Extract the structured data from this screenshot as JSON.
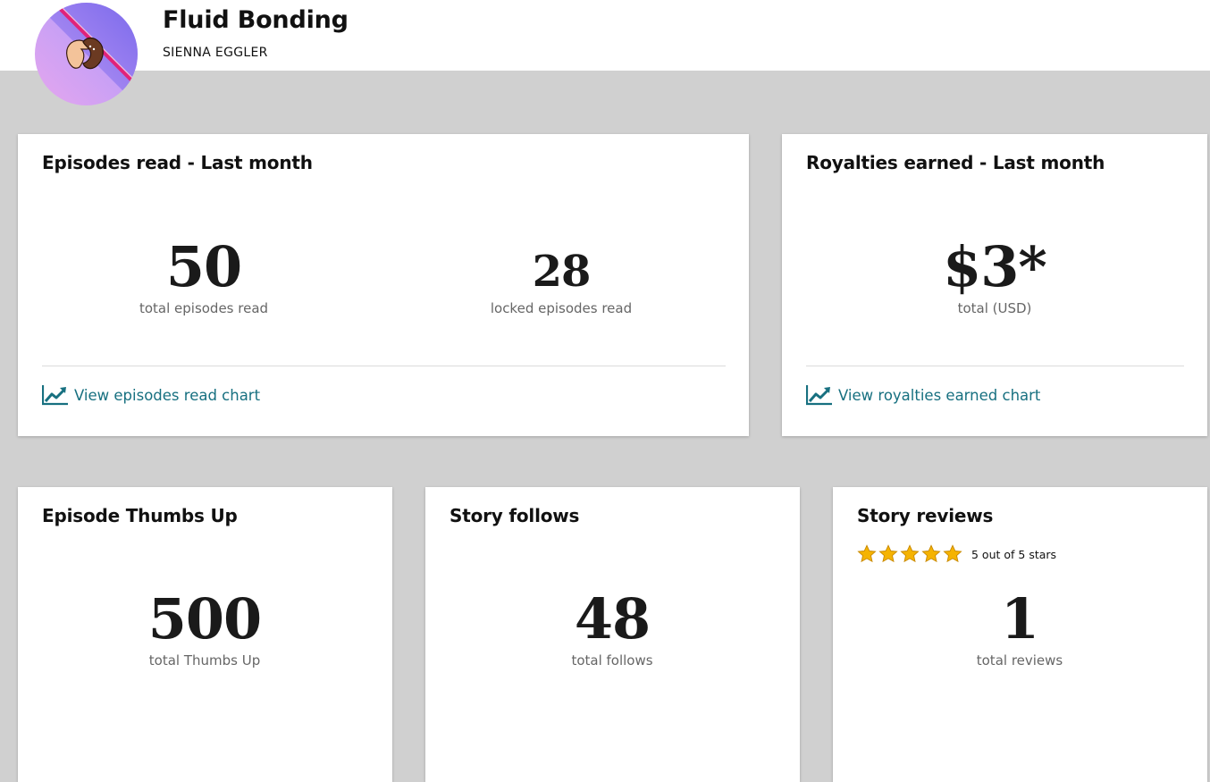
{
  "header": {
    "title": "Fluid Bonding",
    "author": "SIENNA EGGLER",
    "cover_icon": "story-cover-art"
  },
  "colors": {
    "link": "#177080",
    "star": "#f5b301",
    "background": "#d0d0d0"
  },
  "episodes_card": {
    "title": "Episodes read - Last month",
    "total": "50",
    "total_label": "total episodes read",
    "locked": "28",
    "locked_label": "locked episodes read",
    "link_icon": "chart-trend-icon",
    "link_label": "View episodes read chart"
  },
  "royalties_card": {
    "title": "Royalties earned - Last month",
    "total": "$3*",
    "total_label": "total (USD)",
    "link_icon": "chart-trend-icon",
    "link_label": "View royalties earned chart"
  },
  "thumbs_card": {
    "title": "Episode Thumbs Up",
    "total": "500",
    "total_label": "total Thumbs Up"
  },
  "follows_card": {
    "title": "Story follows",
    "total": "48",
    "total_label": "total follows"
  },
  "reviews_card": {
    "title": "Story reviews",
    "rating": 5,
    "rating_max": 5,
    "rating_text": "5 out of 5 stars",
    "total": "1",
    "total_label": "total reviews"
  }
}
